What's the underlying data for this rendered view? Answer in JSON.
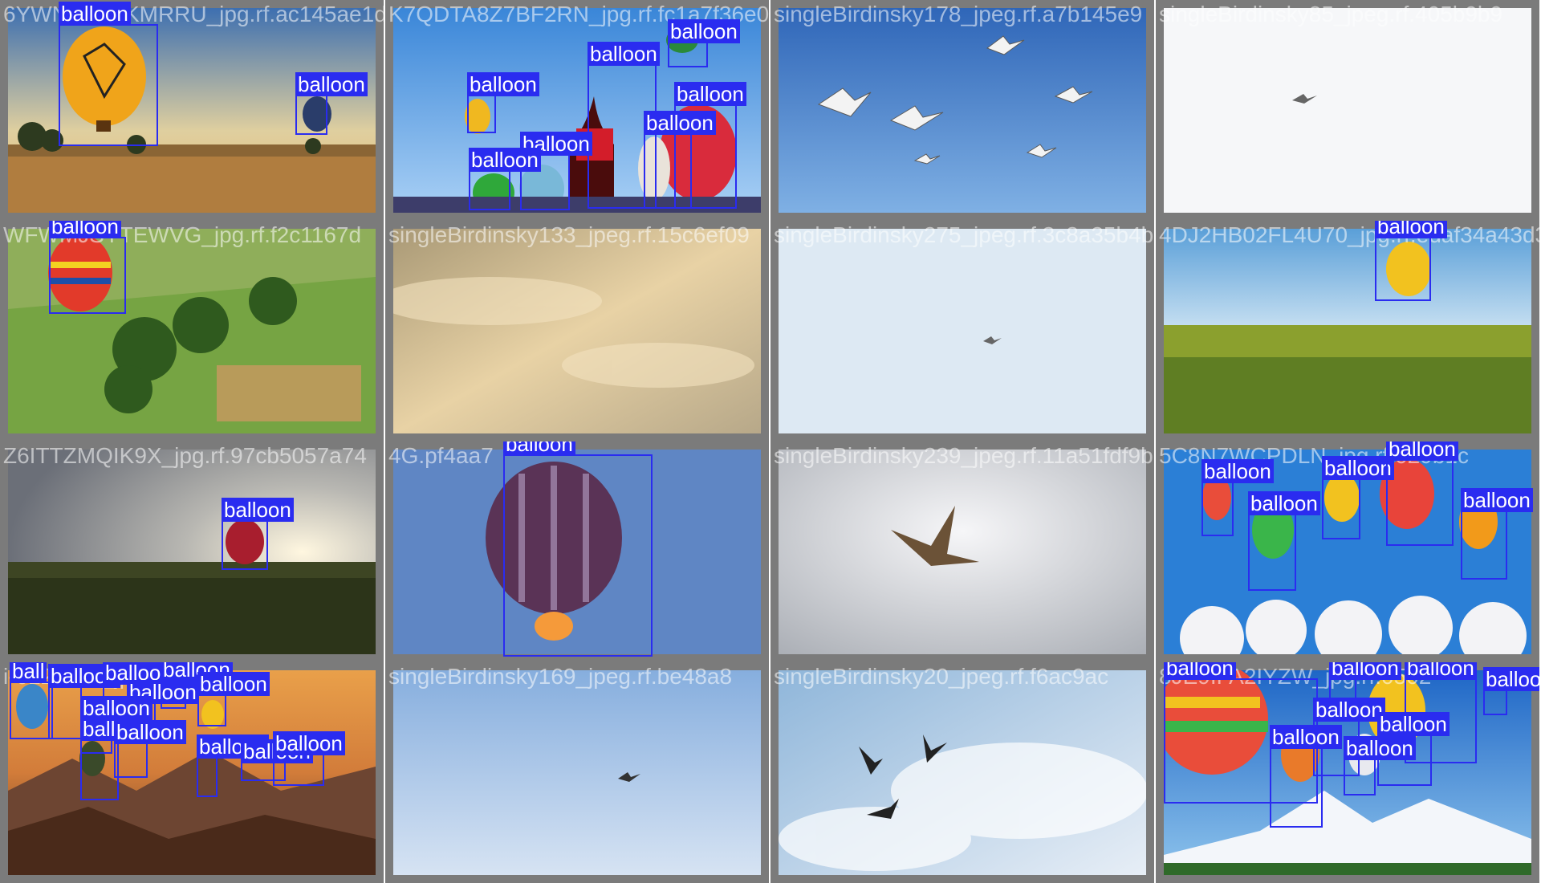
{
  "label_color": "#2a2cf0",
  "tiles": [
    {
      "filename": "6YWNBLDLKMRRU_jpg.rf.ac145ae1d7",
      "scene": "field-sunset",
      "boxes": [
        {
          "label": "balloon"
        },
        {
          "label": "balloon"
        }
      ]
    },
    {
      "filename": "K7QDTA8Z7BF2RN_jpg.rf.fc1a7f36e06",
      "scene": "festival",
      "boxes": [
        {
          "label": "balloon"
        },
        {
          "label": "balloon"
        },
        {
          "label": "balloon"
        },
        {
          "label": "balloon"
        },
        {
          "label": "balloon"
        },
        {
          "label": "balloon"
        },
        {
          "label": "balloon"
        }
      ]
    },
    {
      "filename": "singleBirdinsky178_jpeg.rf.a7b145e9",
      "scene": "gulls",
      "boxes": []
    },
    {
      "filename": "singleBirdinsky85_jpeg.rf.405b9b9",
      "scene": "white-sky",
      "boxes": []
    },
    {
      "filename": "WFWMJSYTEWVG_jpg.rf.f2c1167d",
      "scene": "green-hills",
      "boxes": [
        {
          "label": "balloon"
        }
      ]
    },
    {
      "filename": "singleBirdinsky133_jpeg.rf.15c6ef09",
      "scene": "cloudy-sepia",
      "boxes": []
    },
    {
      "filename": "singleBirdinsky275_jpeg.rf.3c8a35b4b",
      "scene": "pale-sky",
      "boxes": []
    },
    {
      "filename": "4DJ2HB02FL4U70_jpg.rf.edaf34a43d3",
      "scene": "valley",
      "boxes": [
        {
          "label": "balloon"
        }
      ]
    },
    {
      "filename": "Z6ITTZMQIK9X_jpg.rf.97cb5057a74",
      "scene": "sunset-field",
      "boxes": [
        {
          "label": "balloon"
        }
      ]
    },
    {
      "filename": "4G.pf4aa7",
      "scene": "burning-balloon",
      "boxes": [
        {
          "label": "balloon"
        }
      ]
    },
    {
      "filename": "singleBirdinsky239_jpeg.rf.11a51fdf9b",
      "scene": "hawk",
      "boxes": []
    },
    {
      "filename": "5C8N7WCPDLN_jpg.rf.029b1c",
      "scene": "paper-balloons",
      "boxes": [
        {
          "label": "balloon"
        },
        {
          "label": "balloon"
        },
        {
          "label": "balloon"
        },
        {
          "label": "balloon"
        },
        {
          "label": "balloon"
        }
      ]
    },
    {
      "filename": "i-612x612_jpg.rf5",
      "scene": "mountain-sunset",
      "boxes": [
        {
          "label": "ball"
        },
        {
          "label": "balloon"
        },
        {
          "label": "balloon"
        },
        {
          "label": "balloon"
        },
        {
          "label": "balloon"
        },
        {
          "label": "balloon"
        },
        {
          "label": "balloon"
        },
        {
          "label": "balloon"
        },
        {
          "label": "balloon"
        },
        {
          "label": "balloon"
        },
        {
          "label": "balloon"
        },
        {
          "label": "balloon"
        }
      ]
    },
    {
      "filename": "singleBirdinsky169_jpeg.rf.be48a8",
      "scene": "blue-gradient",
      "boxes": []
    },
    {
      "filename": "singleBirdinsky20_jpeg.rf.f6ac9ac",
      "scene": "birds-clouds",
      "boxes": []
    },
    {
      "filename": "8JE9IFA2IYZW_jpg.rf.0502",
      "scene": "snow-mountain",
      "boxes": [
        {
          "label": "balloon"
        },
        {
          "label": "balloon"
        },
        {
          "label": "balloon"
        },
        {
          "label": "balloon"
        },
        {
          "label": "balloon"
        },
        {
          "label": "balloon"
        },
        {
          "label": "balloon"
        },
        {
          "label": "balloon"
        }
      ]
    }
  ]
}
